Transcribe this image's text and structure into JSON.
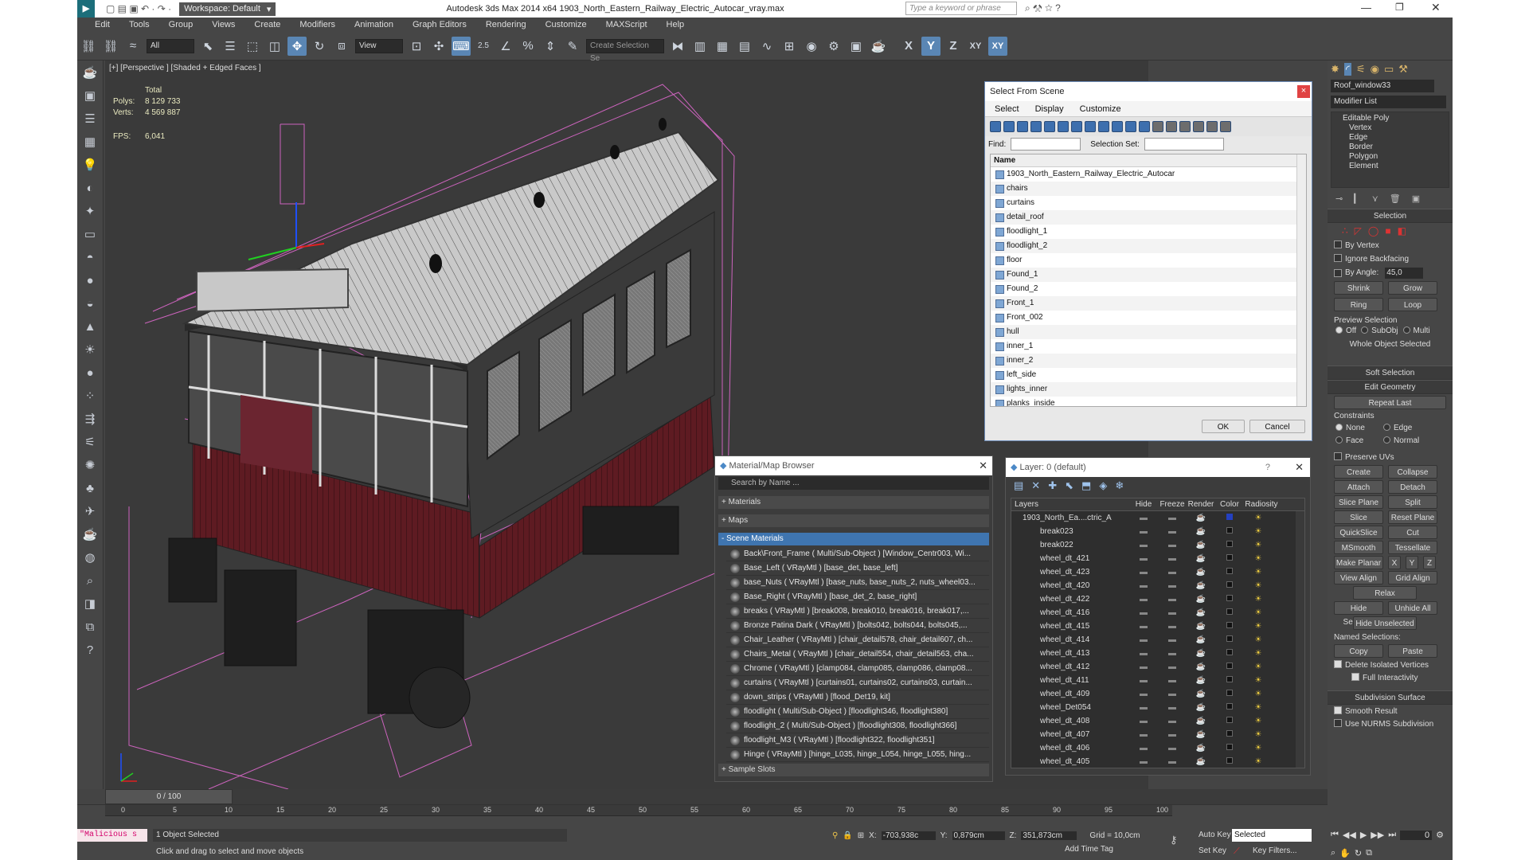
{
  "titlebar": {
    "workspace": "Workspace: Default",
    "title": "Autodesk 3ds Max  2014 x64    1903_North_Eastern_Railway_Electric_Autocar_vray.max",
    "search_placeholder": "Type a keyword or phrase"
  },
  "menu": [
    "Edit",
    "Tools",
    "Group",
    "Views",
    "Create",
    "Modifiers",
    "Animation",
    "Graph Editors",
    "Rendering",
    "Customize",
    "MAXScript",
    "Help"
  ],
  "toolbar": {
    "filter": "All",
    "refcoord": "View",
    "named_sel": "Create Selection Se",
    "axes": [
      "X",
      "Y",
      "Z",
      "XY",
      "XY"
    ],
    "snap_num": "2.5"
  },
  "viewport": {
    "label": "[+] [Perspective ] [Shaded + Edged Faces ]",
    "stats_total": "Total",
    "polys_label": "Polys:",
    "polys": "8 129 733",
    "verts_label": "Verts:",
    "verts": "4 569 887",
    "fps_label": "FPS:",
    "fps": "6,041"
  },
  "select_from_scene": {
    "title": "Select From Scene",
    "tabs": [
      "Select",
      "Display",
      "Customize"
    ],
    "find_label": "Find:",
    "selset_label": "Selection Set:",
    "col_name": "Name",
    "items": [
      "1903_North_Eastern_Railway_Electric_Autocar",
      "chairs",
      "curtains",
      "detail_roof",
      "floodlight_1",
      "floodlight_2",
      "floor",
      "Found_1",
      "Found_2",
      "Front_1",
      "Front_002",
      "hull",
      "inner_1",
      "inner_2",
      "left_side",
      "lights_inner",
      "planks_inside"
    ],
    "ok": "OK",
    "cancel": "Cancel"
  },
  "material_browser": {
    "title": "Material/Map Browser",
    "search_placeholder": "Search by Name ...",
    "groups": [
      "+ Materials",
      "+ Maps",
      "- Scene Materials",
      "+ Sample Slots"
    ],
    "items": [
      "Back\\Front_Frame  ( Multi/Sub-Object )  [Window_Centr003, Wi...",
      "Base_Left  ( VRayMtl )  [base_det, base_left]",
      "base_Nuts  ( VRayMtl )  [base_nuts, base_nuts_2, nuts_wheel03...",
      "Base_Right  ( VRayMtl )  [base_det_2, base_right]",
      "breaks  ( VRayMtl )  [break008, break010, break016, break017,...",
      "Bronze Patina Dark  ( VRayMtl )  [bolts042, bolts044, bolts045,...",
      "Chair_Leather  ( VRayMtl )  [chair_detail578, chair_detail607, ch...",
      "Chairs_Metal  ( VRayMtl )  [chair_detail554, chair_detail563, cha...",
      "Chrome  ( VRayMtl )  [clamp084, clamp085, clamp086, clamp08...",
      "curtains  ( VRayMtl )  [curtains01, curtains02, curtains03, curtain...",
      "down_strips  ( VRayMtl )  [flood_Det19, kit]",
      "floodlight  ( Multi/Sub-Object )  [floodlight346, floodlight380]",
      "floodlight_2  ( Multi/Sub-Object )  [floodlight308, floodlight366]",
      "floodlight_M3  ( VRayMtl )  [floodlight322, floodlight351]",
      "Hinge  ( VRayMtl )  [hinge_L035, hinge_L054, hinge_L055, hing..."
    ]
  },
  "layer_dialog": {
    "title": "Layer: 0 (default)",
    "cols": [
      "Layers",
      "Hide",
      "Freeze",
      "Render",
      "Color",
      "Radiosity"
    ],
    "root": "1903_North_Ea....ctric_A",
    "items": [
      "break023",
      "break022",
      "wheel_dt_421",
      "wheel_dt_423",
      "wheel_dt_420",
      "wheel_dt_422",
      "wheel_dt_416",
      "wheel_dt_415",
      "wheel_dt_414",
      "wheel_dt_413",
      "wheel_dt_412",
      "wheel_dt_411",
      "wheel_dt_409",
      "wheel_Det054",
      "wheel_dt_408",
      "wheel_dt_407",
      "wheel_dt_406",
      "wheel_dt_405"
    ]
  },
  "command_panel": {
    "object_name": "Roof_window33",
    "modifier_list": "Modifier List",
    "stack": [
      "Editable Poly",
      "Vertex",
      "Edge",
      "Border",
      "Polygon",
      "Element"
    ],
    "selection": {
      "title": "Selection",
      "by_vertex": "By Vertex",
      "ignore_backfacing": "Ignore Backfacing",
      "by_angle": "By Angle:",
      "angle_val": "45,0",
      "shrink": "Shrink",
      "grow": "Grow",
      "ring": "Ring",
      "loop": "Loop",
      "preview": "Preview Selection",
      "off": "Off",
      "subobj": "SubObj",
      "multi": "Multi",
      "whole": "Whole Object Selected"
    },
    "soft_selection": "Soft Selection",
    "edit_geometry": {
      "title": "Edit Geometry",
      "repeat_last": "Repeat Last",
      "constraints": "Constraints",
      "none": "None",
      "edge": "Edge",
      "face": "Face",
      "normal": "Normal",
      "preserve_uvs": "Preserve UVs",
      "create": "Create",
      "collapse": "Collapse",
      "attach": "Attach",
      "detach": "Detach",
      "slice_plane": "Slice Plane",
      "split": "Split",
      "slice": "Slice",
      "reset_plane": "Reset Plane",
      "quickslice": "QuickSlice",
      "cut": "Cut",
      "msmooth": "MSmooth",
      "tessellate": "Tessellate",
      "make_planar": "Make Planar",
      "x": "X",
      "y": "Y",
      "z": "Z",
      "view_align": "View Align",
      "grid_align": "Grid Align",
      "relax": "Relax",
      "hide_selected": "Hide Selected",
      "unhide_all": "Unhide All",
      "hide_unselected": "Hide Unselected",
      "named_selections": "Named Selections:",
      "copy": "Copy",
      "paste": "Paste",
      "delete_isolated": "Delete Isolated Vertices",
      "full_interactivity": "Full Interactivity"
    },
    "subdivision": {
      "title": "Subdivision Surface",
      "smooth_result": "Smooth Result",
      "use_nurms": "Use NURMS Subdivision"
    }
  },
  "timeline": {
    "frame": "0 / 100",
    "ticks": [
      "0",
      "5",
      "10",
      "15",
      "20",
      "25",
      "30",
      "35",
      "40",
      "45",
      "50",
      "55",
      "60",
      "65",
      "70",
      "75",
      "80",
      "85",
      "90",
      "95",
      "100"
    ]
  },
  "status": {
    "maxscript": "\"Malicious s",
    "selected": "1 Object Selected",
    "prompt": "Click and drag to select and move objects",
    "x_label": "X:",
    "x": "-703,938c",
    "y_label": "Y:",
    "y": "0,879cm",
    "z_label": "Z:",
    "z": "351,873cm",
    "grid": "Grid = 10,0cm",
    "auto_key": "Auto Key",
    "set_key": "Set Key",
    "selected_dd": "Selected",
    "key_filters": "Key Filters...",
    "add_time_tag": "Add Time Tag",
    "frame_val": "0"
  },
  "colors": {
    "accent": "#5a86b4",
    "wire": "#e66bd4",
    "hull": "#5e1b22"
  }
}
